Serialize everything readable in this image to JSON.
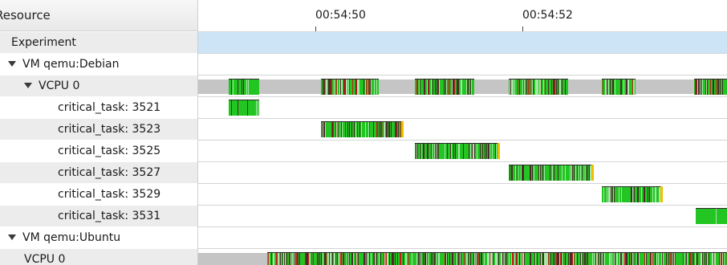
{
  "tree": {
    "header": "Resource",
    "rows": [
      {
        "label": "Experiment",
        "indent": 0,
        "toggle": false
      },
      {
        "label": "VM qemu:Debian",
        "indent": 1,
        "toggle": true
      },
      {
        "label": "VCPU 0",
        "indent": 2,
        "toggle": true
      },
      {
        "label": "critical_task: 3521",
        "indent": 3,
        "toggle": false
      },
      {
        "label": "critical_task: 3523",
        "indent": 3,
        "toggle": false
      },
      {
        "label": "critical_task: 3525",
        "indent": 3,
        "toggle": false
      },
      {
        "label": "critical_task: 3527",
        "indent": 3,
        "toggle": false
      },
      {
        "label": "critical_task: 3529",
        "indent": 3,
        "toggle": false
      },
      {
        "label": "critical_task: 3531",
        "indent": 3,
        "toggle": false
      },
      {
        "label": "VM qemu:Ubuntu",
        "indent": 1,
        "toggle": true
      },
      {
        "label": "VCPU 0",
        "indent": 2,
        "toggle": false
      }
    ]
  },
  "timeline": {
    "ticks": [
      "00:54:50",
      "00:54:52"
    ]
  },
  "colors": {
    "running": "#22c522",
    "dark_segment": "#4a2a2a",
    "preempted": "#c61a1a",
    "waiting": "#f0c000",
    "idle": "#c5c5c5",
    "experiment": "#cde4f7",
    "row_alt": "#ececec"
  }
}
